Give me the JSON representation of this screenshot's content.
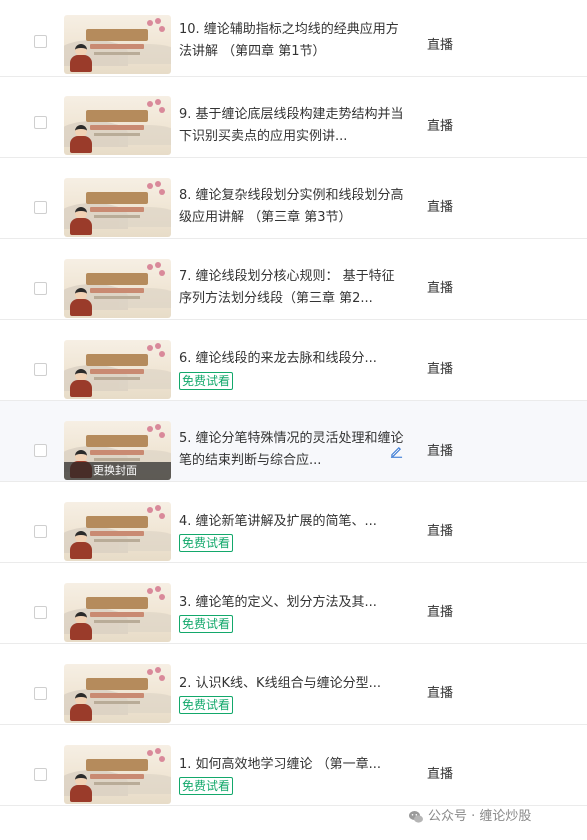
{
  "rows": [
    {
      "title": "10. 缠论辅助指标之均线的经典应用方法讲解 （第四章 第1节）",
      "type": "直播",
      "badge": "",
      "cover_overlay": ""
    },
    {
      "title": "9. 基于缠论底层线段构建走势结构并当下识别买卖点的应用实例讲...",
      "type": "直播",
      "badge": "",
      "cover_overlay": ""
    },
    {
      "title": "8. 缠论复杂线段划分实例和线段划分高级应用讲解 （第三章 第3节）",
      "type": "直播",
      "badge": "",
      "cover_overlay": ""
    },
    {
      "title": "7. 缠论线段划分核心规则： 基于特征序列方法划分线段（第三章 第2...",
      "type": "直播",
      "badge": "",
      "cover_overlay": ""
    },
    {
      "title": "6. 缠论线段的来龙去脉和线段分...",
      "type": "直播",
      "badge": "免费试看",
      "cover_overlay": ""
    },
    {
      "title": "5. 缠论分笔特殊情况的灵活处理和缠论笔的结束判断与综合应...",
      "type": "直播",
      "badge": "",
      "cover_overlay": "更换封面"
    },
    {
      "title": "4. 缠论新笔讲解及扩展的简笔、...",
      "type": "直播",
      "badge": "免费试看",
      "cover_overlay": ""
    },
    {
      "title": "3. 缠论笔的定义、划分方法及其...",
      "type": "直播",
      "badge": "免费试看",
      "cover_overlay": ""
    },
    {
      "title": "2. 认识K线、K线组合与缠论分型...",
      "type": "直播",
      "badge": "免费试看",
      "cover_overlay": ""
    },
    {
      "title": "1. 如何高效地学习缠论 （第一章...",
      "type": "直播",
      "badge": "免费试看",
      "cover_overlay": ""
    }
  ],
  "watermark": "公众号 · 缠论炒股",
  "colors": {
    "badge_green": "#13a86b",
    "edit_blue": "#3a7bd5",
    "row_highlight": "#f7f8fb"
  }
}
